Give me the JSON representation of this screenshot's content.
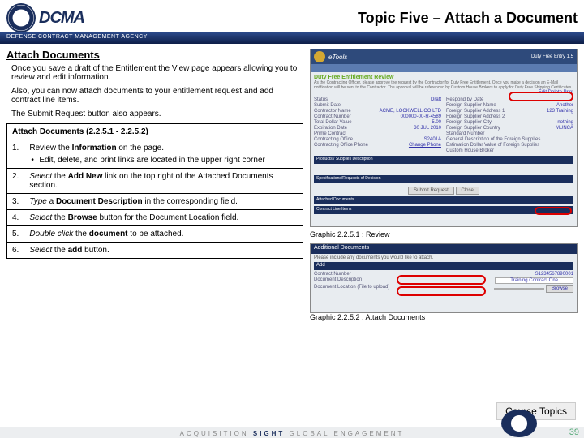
{
  "header": {
    "agency_line": "DEFENSE CONTRACT MANAGEMENT AGENCY",
    "logo_text": "DCMA",
    "topic_title": "Topic Five – Attach a Document"
  },
  "section_title": "Attach Documents",
  "intro": {
    "p1": "Once you save a draft of the Entitlement the View page appears allowing you to review and edit information.",
    "p2": "Also, you can now attach documents to your entitlement request and add contract line items.",
    "p3": "The Submit Request button also appears."
  },
  "table": {
    "header": "Attach Documents (2.2.5.1 - 2.2.5.2)",
    "rows": [
      {
        "n": "1.",
        "html": "Review the <b>Information</b> on the page.",
        "bullet": "Edit, delete, and print links are located in the upper right corner"
      },
      {
        "n": "2.",
        "html": "<i>Select</i> the <b>Add New</b> link on the top right of the Attached Documents section."
      },
      {
        "n": "3.",
        "html": "<i>Type</i> a <b>Document Description</b> in the corresponding field."
      },
      {
        "n": "4.",
        "html": "<i>Select</i> the <b>Browse</b> button for the Document Location field."
      },
      {
        "n": "5.",
        "html": "<i>Double click</i> the <b>document</b> to be attached."
      },
      {
        "n": "6.",
        "html": "<i>Select</i> the <b>add</b> button."
      }
    ]
  },
  "screenshot1": {
    "etools": "eTools",
    "duty_bar": "Duty Free Entry 1.5",
    "title": "Duty Free Entitlement Review",
    "sub": "As the Contracting Officer, please approve the request by the Contractor for Duty Free Entitlement. Once you make a decision an E-Mail notification will be sent to the Contractor. The approval will be referenced by Custom House Brokers to apply for Duty Free Shipping Certificates.",
    "links": "Edit  Delete  Print",
    "left_fields": {
      "status": "Status",
      "status_v": "Draft",
      "submit": "Submit Date",
      "submit_v": "",
      "cname": "Contractor Name",
      "cname_v": "ACME, LOCKWELL CO LTD",
      "cnum": "Contract Number",
      "cnum_v": "000000-00-R-4589",
      "tdv": "Total Dollar Value",
      "tdv_v": "5.00",
      "exp": "Expiration Date",
      "exp_v": "30 JUL 2010",
      "prime": "Prime Contract",
      "prime_v": "",
      "co": "Contracting Office",
      "co_v": "S2401A",
      "cphone": "Contracting Office Phone",
      "cphone_v": "Change Phone"
    },
    "right_fields": {
      "respond": "Respond by Date",
      "fs": "Foreign Supplier Name",
      "fs_v": "Another",
      "fa1": "Foreign Supplier Address 1",
      "fa1_v": "123 Training",
      "fa2": "Foreign Supplier Address 2",
      "fcity": "Foreign Supplier City",
      "fcity_v": "nothing",
      "fcountry": "Foreign Supplier Country",
      "fcountry_v": "MUNCA",
      "sn": "Standard Number",
      "desc": "General Description of the Foreign Supplies",
      "est": "Estimation Dollar Value of Foreign Supplies",
      "chb": "Custom House Broker"
    },
    "bar1": "Products / Supplies Description",
    "bar2": "Specifications/Requests of Decision",
    "btn1": "Submit Request",
    "btn2": "Close",
    "attached_bar": "Attached Documents",
    "clin_bar": "Contract Line Items"
  },
  "caption1": "Graphic 2.2.5.1 : Review",
  "screenshot2": {
    "head": "Additional Documents",
    "sub": "Please include any documents you would like to attach.",
    "add": "Add",
    "f1": "Contract Number",
    "f1v": "S1234567890001",
    "f2": "Document Description",
    "f2v": "Training Contract One",
    "f3": "Document Location (File to upload)",
    "browse": "Browse"
  },
  "caption2": "Graphic 2.2.5.2 : Attach Documents",
  "footer": {
    "course_topics": "Course Topics",
    "tagline_a": "ACQUISITION",
    "tagline_b": "SIGHT",
    "tagline_c": "GLOBAL ENGAGEMENT",
    "page": "39"
  }
}
